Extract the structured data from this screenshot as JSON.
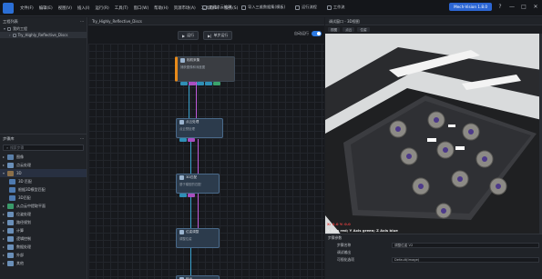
{
  "app": {
    "menu": [
      "文件(F)",
      "编辑(E)",
      "视图(V)",
      "插入(I)",
      "运行(R)",
      "工具(T)",
      "窗口(W)",
      "帮助(H)",
      "资源市场(A)",
      "工具箱(B)",
      "服务(S)",
      "帮助(H)"
    ],
    "center_actions": [
      "三维点云检测",
      "导入三维数据集(模板)",
      "运行流程",
      "工作流"
    ],
    "user_label": "Mech-Vision 1.8.0",
    "window_controls": [
      "?",
      "—",
      "□",
      "✕"
    ]
  },
  "left": {
    "projects_title": "工程列表",
    "project_root": "我的工程",
    "project_child": "Try_Highly_Reflective_Discs",
    "ops_title": "步骤库",
    "search_placeholder": "搜索步骤",
    "categories": [
      "图像",
      "点云处理",
      "3D",
      "3D匹配",
      "位姿处理",
      "路径规划",
      "计算",
      "逻辑控制",
      "数据处理",
      "外部",
      "其他"
    ],
    "subitems": [
      "3D 匹配",
      "根据3D模型匹配",
      "3D匹配",
      "从点云中提取平面"
    ]
  },
  "editor": {
    "tab": "Try_Highly_Reflective_Discs",
    "run_btn": "运行",
    "debug_btn": "单步运行",
    "toggle_label": "自动运行",
    "nodes": [
      {
        "title": "相机采集",
        "sub": "捕获图像和深度图"
      },
      {
        "title": "点云处理",
        "sub": "点云预处理"
      },
      {
        "title": "3D匹配",
        "sub": "基于模型的匹配"
      },
      {
        "title": "位姿调整",
        "sub": "调整位姿"
      },
      {
        "title": "输出",
        "sub": ""
      }
    ]
  },
  "right": {
    "tab": "调试窗口 - 3D视图",
    "tools": [
      "视图",
      "点云",
      "位姿"
    ],
    "axis_hint_1": "X: 0.0  Y: 0.0",
    "axis_hint_2": "X Axis red; Y Axis green; Z Axis blue",
    "reset_hint": "Press r/R to reset camera view point to center",
    "props_title": "步骤参数",
    "prop_rows": [
      {
        "label": "步骤名称",
        "value": "调整位姿 V2"
      },
      {
        "label": "调试输出",
        "value": ""
      },
      {
        "label": "可视化选项",
        "value": "Default(Image)"
      }
    ]
  }
}
